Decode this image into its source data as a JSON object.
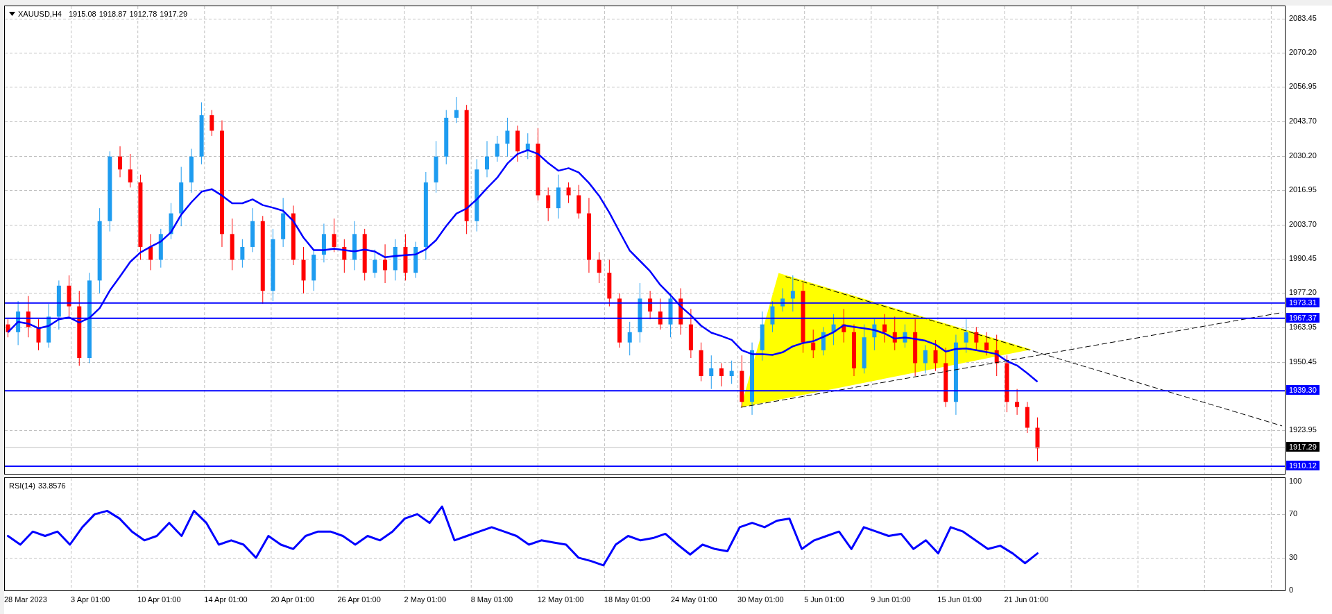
{
  "chart": {
    "symbol": "XAUUSD,H4",
    "ohlc": [
      "1915.08",
      "1918.87",
      "1912.78",
      "1917.29"
    ],
    "price_axis": [
      "2083.45",
      "2070.20",
      "2056.95",
      "2043.70",
      "2030.20",
      "2016.95",
      "2003.70",
      "1990.45",
      "1977.20",
      "1963.95",
      "1950.45",
      "1923.95"
    ],
    "price_lines": [
      {
        "kind": "level",
        "price": "1973.31"
      },
      {
        "kind": "level",
        "price": "1967.37"
      },
      {
        "kind": "level",
        "price": "1939.30"
      },
      {
        "kind": "bid",
        "price": "1917.29"
      },
      {
        "kind": "level",
        "price": "1910.12"
      }
    ]
  },
  "rsi": {
    "value": "33.8576",
    "chart_data": {
      "type": "line",
      "grid": true,
      "ylim": [
        -1.3,
        103.2
      ],
      "yticks": [
        {
          "value": 100,
          "label": "100"
        },
        {
          "value": 70,
          "label": "70"
        },
        {
          "value": 30,
          "label": "30"
        },
        {
          "value": 0,
          "label": "0"
        }
      ],
      "series": [
        {
          "name": "RSI(14)",
          "color": "#0000ff",
          "values": [
            50,
            42,
            54,
            50,
            54,
            42,
            58,
            70,
            73,
            66,
            54,
            46,
            50,
            62,
            50,
            73,
            62,
            42,
            46,
            42,
            30,
            50,
            42,
            38,
            50,
            54,
            54,
            50,
            42,
            50,
            46,
            54,
            66,
            70,
            62,
            77,
            46,
            50,
            54,
            58,
            54,
            50,
            42,
            46,
            44,
            42,
            30,
            27,
            23,
            42,
            50,
            46,
            48,
            52,
            42,
            33,
            42,
            38,
            36,
            58,
            62,
            58,
            64,
            66,
            38,
            46,
            50,
            54,
            38,
            58,
            54,
            50,
            52,
            38,
            46,
            34,
            58,
            54,
            46,
            38,
            41,
            34,
            25,
            34
          ]
        }
      ]
    }
  },
  "time_axis": [
    "28 Mar 2023",
    "3 Apr 01:00",
    "10 Apr 01:00",
    "14 Apr 01:00",
    "20 Apr 01:00",
    "26 Apr 01:00",
    "2 May 01:00",
    "8 May 01:00",
    "12 May 01:00",
    "18 May 01:00",
    "24 May 01:00",
    "30 May 01:00",
    "5 Jun 01:00",
    "9 Jun 01:00",
    "15 Jun 01:00",
    "21 Jun 01:00"
  ]
}
